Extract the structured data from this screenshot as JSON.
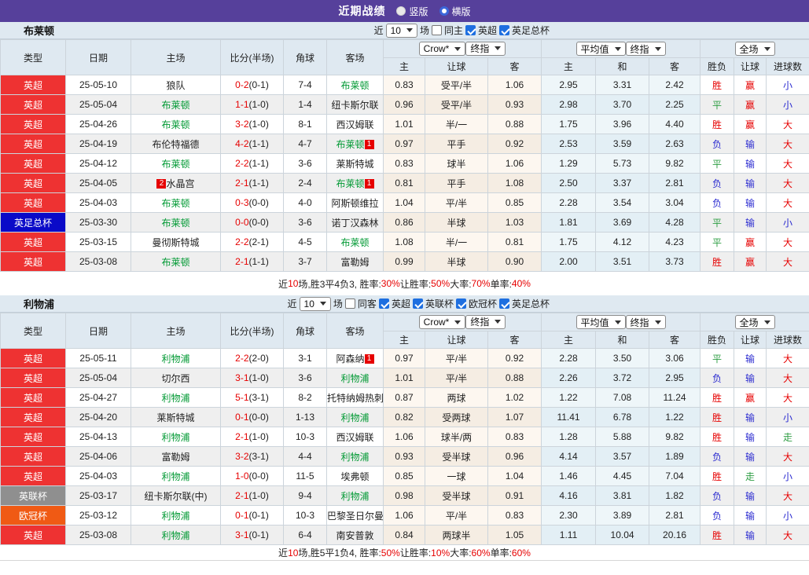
{
  "topbar": {
    "title": "近期战绩",
    "vertical": "竖版",
    "horizontal": "横版"
  },
  "colors": {
    "topbar_bg": "#56409b",
    "section_bar_bg": "#dfe9f1",
    "header_bg": "#dfe9f1",
    "team_green": "#009933",
    "score_red": "#e60000",
    "summary_red": "#e60000",
    "rank_badge_bg": "#e60000",
    "leagues": {
      "英超": "#ee3232",
      "英足总杯": "#0a0ac8",
      "英联杯": "#8f8f8f",
      "欧冠杯": "#f05a14"
    },
    "result": {
      "r": "#e60000",
      "g": "#2f9e44",
      "b": "#2b2bd0"
    }
  },
  "table_header": {
    "left_cols": [
      "类型",
      "日期",
      "主场",
      "比分(半场)",
      "角球",
      "客场"
    ],
    "groups": [
      {
        "selects": [
          {
            "label": "Crow*",
            "name": "odds-company-select"
          },
          {
            "label": "终指",
            "name": "odds-stage-select"
          }
        ],
        "cols": [
          "主",
          "让球",
          "客"
        ]
      },
      {
        "selects": [
          {
            "label": "平均值",
            "name": "average-source-select"
          },
          {
            "label": "终指",
            "name": "average-stage-select"
          }
        ],
        "cols": [
          "主",
          "和",
          "客"
        ]
      },
      {
        "selects": [
          {
            "label": "全场",
            "name": "scope-select"
          }
        ],
        "cols": [
          "胜负",
          "让球",
          "进球数"
        ]
      }
    ]
  },
  "sections": [
    {
      "team": "布莱顿",
      "filter": {
        "near": "近",
        "count": "10",
        "unit": "场",
        "same_label": "同主",
        "same_checked": false,
        "leagues": [
          {
            "label": "英超",
            "checked": true
          },
          {
            "label": "英足总杯",
            "checked": true
          }
        ]
      },
      "rows": [
        {
          "l": "英超",
          "d": "25-05-10",
          "h": "狼队",
          "hg": false,
          "s": "0-2",
          "sh": "(0-1)",
          "c": "7-4",
          "a": "布莱顿",
          "ag": true,
          "o": [
            "0.83",
            "受平/半",
            "1.06"
          ],
          "m": [
            "2.95",
            "3.31",
            "2.42"
          ],
          "r": [
            "胜",
            "r"
          ],
          "hc": [
            "赢",
            "r"
          ],
          "g": [
            "小",
            "b"
          ]
        },
        {
          "l": "英超",
          "d": "25-05-04",
          "h": "布莱顿",
          "hg": true,
          "s": "1-1",
          "sh": "(1-0)",
          "c": "1-4",
          "a": "纽卡斯尔联",
          "ag": false,
          "o": [
            "0.96",
            "受平/半",
            "0.93"
          ],
          "m": [
            "2.98",
            "3.70",
            "2.25"
          ],
          "r": [
            "平",
            "g"
          ],
          "hc": [
            "赢",
            "r"
          ],
          "g": [
            "小",
            "b"
          ]
        },
        {
          "l": "英超",
          "d": "25-04-26",
          "h": "布莱顿",
          "hg": true,
          "s": "3-2",
          "sh": "(1-0)",
          "c": "8-1",
          "a": "西汉姆联",
          "ag": false,
          "o": [
            "1.01",
            "半/一",
            "0.88"
          ],
          "m": [
            "1.75",
            "3.96",
            "4.40"
          ],
          "r": [
            "胜",
            "r"
          ],
          "hc": [
            "赢",
            "r"
          ],
          "g": [
            "大",
            "r"
          ]
        },
        {
          "l": "英超",
          "d": "25-04-19",
          "h": "布伦特福德",
          "hg": false,
          "s": "4-2",
          "sh": "(1-1)",
          "c": "4-7",
          "a": "布莱顿",
          "ag": true,
          "ab": "1",
          "o": [
            "0.97",
            "平手",
            "0.92"
          ],
          "m": [
            "2.53",
            "3.59",
            "2.63"
          ],
          "r": [
            "负",
            "b"
          ],
          "hc": [
            "输",
            "b"
          ],
          "g": [
            "大",
            "r"
          ]
        },
        {
          "l": "英超",
          "d": "25-04-12",
          "h": "布莱顿",
          "hg": true,
          "s": "2-2",
          "sh": "(1-1)",
          "c": "3-6",
          "a": "莱斯特城",
          "ag": false,
          "o": [
            "0.83",
            "球半",
            "1.06"
          ],
          "m": [
            "1.29",
            "5.73",
            "9.82"
          ],
          "r": [
            "平",
            "g"
          ],
          "hc": [
            "输",
            "b"
          ],
          "g": [
            "大",
            "r"
          ]
        },
        {
          "l": "英超",
          "d": "25-04-05",
          "h": "水晶宫",
          "hg": false,
          "hbp": "2",
          "s": "2-1",
          "sh": "(1-1)",
          "c": "2-4",
          "a": "布莱顿",
          "ag": true,
          "ab": "1",
          "o": [
            "0.81",
            "平手",
            "1.08"
          ],
          "m": [
            "2.50",
            "3.37",
            "2.81"
          ],
          "r": [
            "负",
            "b"
          ],
          "hc": [
            "输",
            "b"
          ],
          "g": [
            "大",
            "r"
          ]
        },
        {
          "l": "英超",
          "d": "25-04-03",
          "h": "布莱顿",
          "hg": true,
          "s": "0-3",
          "sh": "(0-0)",
          "c": "4-0",
          "a": "阿斯顿维拉",
          "ag": false,
          "o": [
            "1.04",
            "平/半",
            "0.85"
          ],
          "m": [
            "2.28",
            "3.54",
            "3.04"
          ],
          "r": [
            "负",
            "b"
          ],
          "hc": [
            "输",
            "b"
          ],
          "g": [
            "大",
            "r"
          ]
        },
        {
          "l": "英足总杯",
          "d": "25-03-30",
          "h": "布莱顿",
          "hg": true,
          "s": "0-0",
          "sh": "(0-0)",
          "c": "3-6",
          "a": "诺丁汉森林",
          "ag": false,
          "o": [
            "0.86",
            "半球",
            "1.03"
          ],
          "m": [
            "1.81",
            "3.69",
            "4.28"
          ],
          "r": [
            "平",
            "g"
          ],
          "hc": [
            "输",
            "b"
          ],
          "g": [
            "小",
            "b"
          ]
        },
        {
          "l": "英超",
          "d": "25-03-15",
          "h": "曼彻斯特城",
          "hg": false,
          "s": "2-2",
          "sh": "(2-1)",
          "c": "4-5",
          "a": "布莱顿",
          "ag": true,
          "o": [
            "1.08",
            "半/一",
            "0.81"
          ],
          "m": [
            "1.75",
            "4.12",
            "4.23"
          ],
          "r": [
            "平",
            "g"
          ],
          "hc": [
            "赢",
            "r"
          ],
          "g": [
            "大",
            "r"
          ]
        },
        {
          "l": "英超",
          "d": "25-03-08",
          "h": "布莱顿",
          "hg": true,
          "s": "2-1",
          "sh": "(1-1)",
          "c": "3-7",
          "a": "富勒姆",
          "ag": false,
          "o": [
            "0.99",
            "半球",
            "0.90"
          ],
          "m": [
            "2.00",
            "3.51",
            "3.73"
          ],
          "r": [
            "胜",
            "r"
          ],
          "hc": [
            "赢",
            "r"
          ],
          "g": [
            "大",
            "r"
          ]
        }
      ],
      "summary": [
        {
          "t": "近"
        },
        {
          "t": "10",
          "red": true
        },
        {
          "t": "场,胜3平4负3, 胜率:"
        },
        {
          "t": "30%",
          "red": true
        },
        {
          "t": " 让胜率:"
        },
        {
          "t": "50%",
          "red": true
        },
        {
          "t": " 大率:"
        },
        {
          "t": "70%",
          "red": true
        },
        {
          "t": " 单率:"
        },
        {
          "t": "40%",
          "red": true
        }
      ]
    },
    {
      "team": "利物浦",
      "filter": {
        "near": "近",
        "count": "10",
        "unit": "场",
        "same_label": "同客",
        "same_checked": false,
        "leagues": [
          {
            "label": "英超",
            "checked": true
          },
          {
            "label": "英联杯",
            "checked": true
          },
          {
            "label": "欧冠杯",
            "checked": true
          },
          {
            "label": "英足总杯",
            "checked": true
          }
        ]
      },
      "rows": [
        {
          "l": "英超",
          "d": "25-05-11",
          "h": "利物浦",
          "hg": true,
          "s": "2-2",
          "sh": "(2-0)",
          "c": "3-1",
          "a": "阿森纳",
          "ag": false,
          "ab": "1",
          "o": [
            "0.97",
            "平/半",
            "0.92"
          ],
          "m": [
            "2.28",
            "3.50",
            "3.06"
          ],
          "r": [
            "平",
            "g"
          ],
          "hc": [
            "输",
            "b"
          ],
          "g": [
            "大",
            "r"
          ]
        },
        {
          "l": "英超",
          "d": "25-05-04",
          "h": "切尔西",
          "hg": false,
          "s": "3-1",
          "sh": "(1-0)",
          "c": "3-6",
          "a": "利物浦",
          "ag": true,
          "o": [
            "1.01",
            "平/半",
            "0.88"
          ],
          "m": [
            "2.26",
            "3.72",
            "2.95"
          ],
          "r": [
            "负",
            "b"
          ],
          "hc": [
            "输",
            "b"
          ],
          "g": [
            "大",
            "r"
          ]
        },
        {
          "l": "英超",
          "d": "25-04-27",
          "h": "利物浦",
          "hg": true,
          "s": "5-1",
          "sh": "(3-1)",
          "c": "8-2",
          "a": "托特纳姆热刺",
          "ag": false,
          "o": [
            "0.87",
            "两球",
            "1.02"
          ],
          "m": [
            "1.22",
            "7.08",
            "11.24"
          ],
          "r": [
            "胜",
            "r"
          ],
          "hc": [
            "赢",
            "r"
          ],
          "g": [
            "大",
            "r"
          ]
        },
        {
          "l": "英超",
          "d": "25-04-20",
          "h": "莱斯特城",
          "hg": false,
          "s": "0-1",
          "sh": "(0-0)",
          "c": "1-13",
          "a": "利物浦",
          "ag": true,
          "o": [
            "0.82",
            "受两球",
            "1.07"
          ],
          "m": [
            "11.41",
            "6.78",
            "1.22"
          ],
          "r": [
            "胜",
            "r"
          ],
          "hc": [
            "输",
            "b"
          ],
          "g": [
            "小",
            "b"
          ]
        },
        {
          "l": "英超",
          "d": "25-04-13",
          "h": "利物浦",
          "hg": true,
          "s": "2-1",
          "sh": "(1-0)",
          "c": "10-3",
          "a": "西汉姆联",
          "ag": false,
          "o": [
            "1.06",
            "球半/两",
            "0.83"
          ],
          "m": [
            "1.28",
            "5.88",
            "9.82"
          ],
          "r": [
            "胜",
            "r"
          ],
          "hc": [
            "输",
            "b"
          ],
          "g": [
            "走",
            "g"
          ]
        },
        {
          "l": "英超",
          "d": "25-04-06",
          "h": "富勒姆",
          "hg": false,
          "s": "3-2",
          "sh": "(3-1)",
          "c": "4-4",
          "a": "利物浦",
          "ag": true,
          "o": [
            "0.93",
            "受半球",
            "0.96"
          ],
          "m": [
            "4.14",
            "3.57",
            "1.89"
          ],
          "r": [
            "负",
            "b"
          ],
          "hc": [
            "输",
            "b"
          ],
          "g": [
            "大",
            "r"
          ]
        },
        {
          "l": "英超",
          "d": "25-04-03",
          "h": "利物浦",
          "hg": true,
          "s": "1-0",
          "sh": "(0-0)",
          "c": "11-5",
          "a": "埃弗顿",
          "ag": false,
          "o": [
            "0.85",
            "一球",
            "1.04"
          ],
          "m": [
            "1.46",
            "4.45",
            "7.04"
          ],
          "r": [
            "胜",
            "r"
          ],
          "hc": [
            "走",
            "g"
          ],
          "g": [
            "小",
            "b"
          ]
        },
        {
          "l": "英联杯",
          "d": "25-03-17",
          "h": "纽卡斯尔联(中)",
          "hg": false,
          "s": "2-1",
          "sh": "(1-0)",
          "c": "9-4",
          "a": "利物浦",
          "ag": true,
          "o": [
            "0.98",
            "受半球",
            "0.91"
          ],
          "m": [
            "4.16",
            "3.81",
            "1.82"
          ],
          "r": [
            "负",
            "b"
          ],
          "hc": [
            "输",
            "b"
          ],
          "g": [
            "大",
            "r"
          ]
        },
        {
          "l": "欧冠杯",
          "d": "25-03-12",
          "h": "利物浦",
          "hg": true,
          "s": "0-1",
          "sh": "(0-1)",
          "c": "10-3",
          "a": "巴黎圣日尔曼",
          "ag": false,
          "o": [
            "1.06",
            "平/半",
            "0.83"
          ],
          "m": [
            "2.30",
            "3.89",
            "2.81"
          ],
          "r": [
            "负",
            "b"
          ],
          "hc": [
            "输",
            "b"
          ],
          "g": [
            "小",
            "b"
          ]
        },
        {
          "l": "英超",
          "d": "25-03-08",
          "h": "利物浦",
          "hg": true,
          "s": "3-1",
          "sh": "(0-1)",
          "c": "6-4",
          "a": "南安普敦",
          "ag": false,
          "o": [
            "0.84",
            "两球半",
            "1.05"
          ],
          "m": [
            "1.11",
            "10.04",
            "20.16"
          ],
          "r": [
            "胜",
            "r"
          ],
          "hc": [
            "输",
            "b"
          ],
          "g": [
            "大",
            "r"
          ]
        }
      ],
      "summary": [
        {
          "t": "近"
        },
        {
          "t": "10",
          "red": true
        },
        {
          "t": "场,胜5平1负4, 胜率:"
        },
        {
          "t": "50%",
          "red": true
        },
        {
          "t": " 让胜率:"
        },
        {
          "t": "10%",
          "red": true
        },
        {
          "t": " 大率:"
        },
        {
          "t": "60%",
          "red": true
        },
        {
          "t": " 单率:"
        },
        {
          "t": "60%",
          "red": true
        }
      ]
    }
  ]
}
